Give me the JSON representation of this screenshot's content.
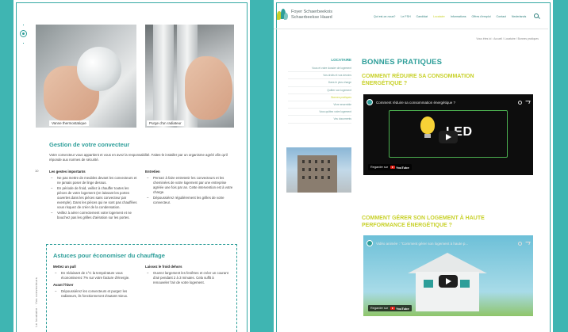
{
  "left_page": {
    "captions": [
      "Vanne thermostatique",
      "Purge d'un radiateur"
    ],
    "page_number": "10",
    "section_title": "Gestion de votre convecteur",
    "intro": "Votre convecteur vous appartient et vous en avez la responsabilité. Faites-le installer par un organisme agréé afin qu'il réponde aux normes de sécurité.",
    "col_left": {
      "title": "Les gestes importants",
      "items": [
        "Ne pas mettre de meubles devant les convecteurs et ne jamais poser de linge dessus.",
        "En période de froid, veillez à chauffer toutes les pièces de votre logement (en laissant les portes ouvertes dans les pièces sans convecteur par exemple). Dans les pièces qui ne sont pas chauffées vous risquez de créer de la condensation.",
        "Veillez à aérer correctement votre logement et ne bouchez pas les grilles d'aération sur les portes."
      ]
    },
    "col_right": {
      "title": "Entretien",
      "items": [
        "Pensez à faire entretenir les convecteurs et les cheminées de votre logement par une entreprise agréée une fois par an. Cette intervention est à votre charge.",
        "Dépoussiérez régulièrement les grilles de votre convecteur."
      ]
    },
    "tips": {
      "title": "Astuces pour économiser du chauffage",
      "left": [
        {
          "heading": "Mettez un pull",
          "items": [
            "En réduisant de 1°C la température vous économiserez 7% sur votre facture d'énergie."
          ]
        },
        {
          "heading": "Avant l'hiver",
          "items": [
            "Dépoussiérez les convecteurs et purgez les radiateurs, ils fonctionneront d'autant mieux."
          ]
        }
      ],
      "right": [
        {
          "heading": "Laissez le froid dehors",
          "items": [
            "Ouvrez largement les fenêtres et créer un courant d'air pendant 2 à 3 minutes. Cela suffit à renouveler l'air de votre logement."
          ]
        }
      ]
    },
    "vertical_text": "Le locataire · Vos convecteurs"
  },
  "right_page": {
    "brand_line1": "Foyer Schaerbeekois",
    "brand_line2": "Schaerbeekse Haard",
    "nav": [
      {
        "label": "Qui est-ce-nous?",
        "active": false
      },
      {
        "label": "Le FSH",
        "active": false
      },
      {
        "label": "Candidat",
        "active": false
      },
      {
        "label": "Locataire",
        "active": true
      },
      {
        "label": "Informations",
        "active": false
      },
      {
        "label": "Offres d'emploi",
        "active": false
      },
      {
        "label": "Contact",
        "active": false
      },
      {
        "label": "Nederlands",
        "active": false
      }
    ],
    "breadcrumb": "Vous êtes ici : Accueil / Locataire / Bonnes pratiques",
    "sidebar_title": "LOCATAIRE",
    "sidebar_items": [
      {
        "label": "Vous et votre dossier de logement",
        "active": false
      },
      {
        "label": "Vos droits et vos devoirs",
        "active": false
      },
      {
        "label": "Dans le plus charge",
        "active": false
      },
      {
        "label": "Quitter son logement",
        "active": false
      },
      {
        "label": "Bonnes pratiques",
        "active": true
      },
      {
        "label": "Vivre ensemble",
        "active": false
      },
      {
        "label": "Vous quittez votre logement",
        "active": false
      },
      {
        "label": "Vos documents",
        "active": false
      }
    ],
    "content_title": "BONNES PRATIQUES",
    "sections": [
      {
        "subtitle": "COMMENT RÉDUIRE SA CONSOMMATION ÉNERGÉTIQUE ?",
        "video_label": "Comment réduire sa consommation énergétique ?",
        "watch_on": "Regarder sur",
        "brand": "YouTube",
        "video_text": "LED"
      },
      {
        "subtitle": "COMMENT GÉRER SON LOGEMENT À HAUTE PERFORMANCE ÉNERGÉTIQUE ?",
        "video_label": "Vidéo animée : \"Comment gérer son logement à haute p...",
        "watch_on": "Regarder sur",
        "brand": "YouTube",
        "video_text": ""
      }
    ]
  },
  "colors": {
    "background": "#3fb5b2",
    "teal": "#2d9e99",
    "lime": "#c8d12a"
  }
}
